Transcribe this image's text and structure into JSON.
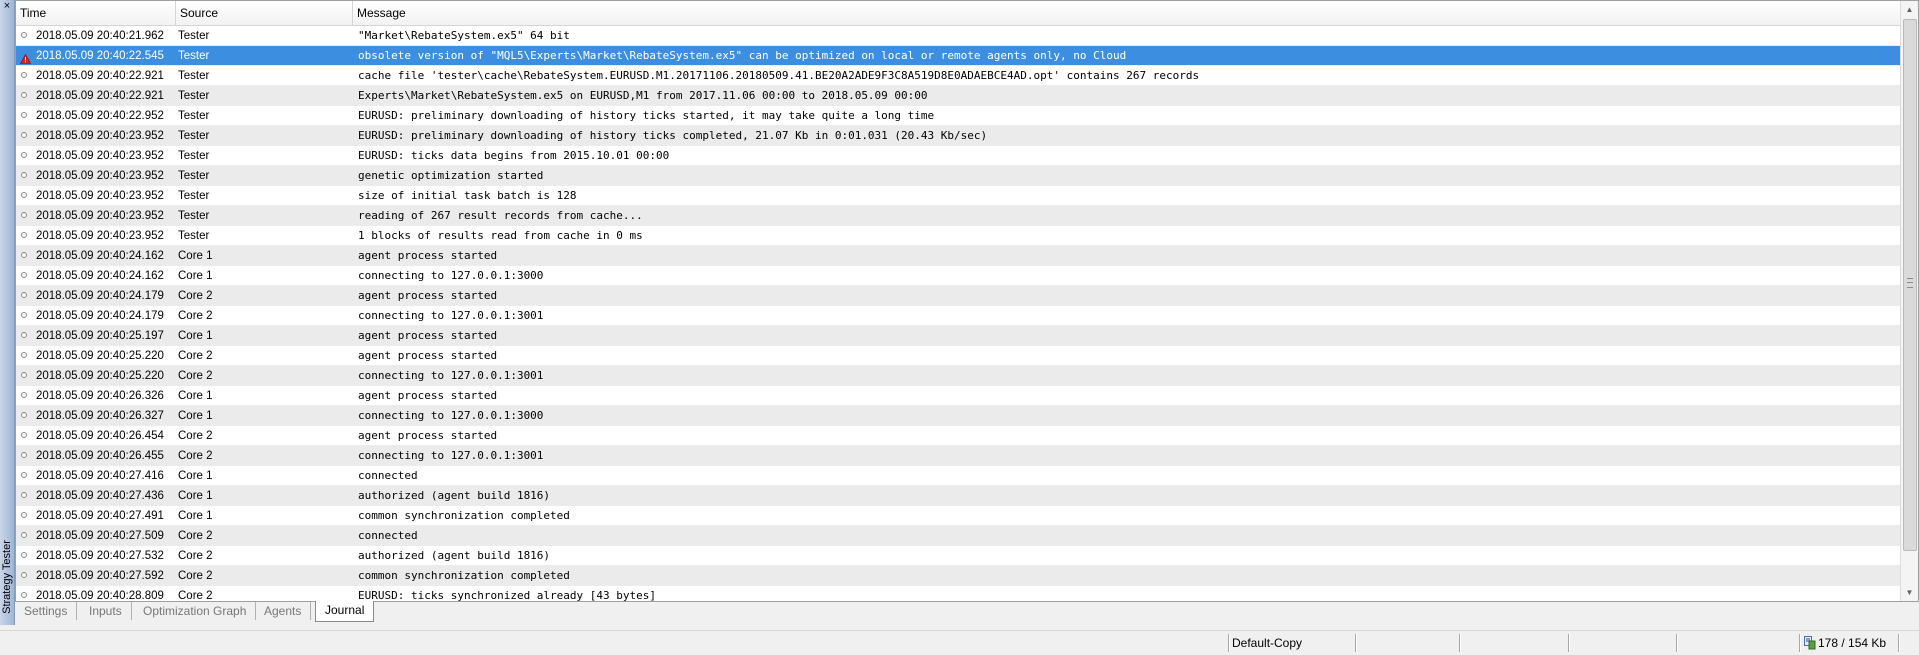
{
  "panel": {
    "vertical_title": "Strategy Tester",
    "close_glyph": "×"
  },
  "columns": {
    "time": "Time",
    "source": "Source",
    "message": "Message"
  },
  "rows": [
    {
      "time": "2018.05.09 20:40:21.962",
      "source": "Tester",
      "message": "\"Market\\RebateSystem.ex5\" 64 bit",
      "icon": "info-icon"
    },
    {
      "time": "2018.05.09 20:40:22.545",
      "source": "Tester",
      "message": "obsolete version of \"MQL5\\Experts\\Market\\RebateSystem.ex5\" can be optimized on local or remote agents only, no Cloud",
      "icon": "warning-icon",
      "selected": true
    },
    {
      "time": "2018.05.09 20:40:22.921",
      "source": "Tester",
      "message": "cache file 'tester\\cache\\RebateSystem.EURUSD.M1.20171106.20180509.41.BE20A2ADE9F3C8A519D8E0ADAEBCE4AD.opt' contains 267 records",
      "icon": "info-icon"
    },
    {
      "time": "2018.05.09 20:40:22.921",
      "source": "Tester",
      "message": "Experts\\Market\\RebateSystem.ex5 on EURUSD,M1 from 2017.11.06 00:00 to 2018.05.09 00:00",
      "icon": "info-icon"
    },
    {
      "time": "2018.05.09 20:40:22.952",
      "source": "Tester",
      "message": "EURUSD: preliminary downloading of history ticks started, it may take quite a long time",
      "icon": "info-icon"
    },
    {
      "time": "2018.05.09 20:40:23.952",
      "source": "Tester",
      "message": "EURUSD: preliminary downloading of history ticks completed, 21.07 Kb in 0:01.031 (20.43 Kb/sec)",
      "icon": "info-icon"
    },
    {
      "time": "2018.05.09 20:40:23.952",
      "source": "Tester",
      "message": "EURUSD: ticks data begins from 2015.10.01 00:00",
      "icon": "info-icon"
    },
    {
      "time": "2018.05.09 20:40:23.952",
      "source": "Tester",
      "message": "genetic optimization started",
      "icon": "info-icon"
    },
    {
      "time": "2018.05.09 20:40:23.952",
      "source": "Tester",
      "message": "size of initial task batch is 128",
      "icon": "info-icon"
    },
    {
      "time": "2018.05.09 20:40:23.952",
      "source": "Tester",
      "message": "reading of 267 result records from cache...",
      "icon": "info-icon"
    },
    {
      "time": "2018.05.09 20:40:23.952",
      "source": "Tester",
      "message": "1 blocks of results read from cache in 0 ms",
      "icon": "info-icon"
    },
    {
      "time": "2018.05.09 20:40:24.162",
      "source": "Core 1",
      "message": "agent process started",
      "icon": "info-icon"
    },
    {
      "time": "2018.05.09 20:40:24.162",
      "source": "Core 1",
      "message": "connecting to 127.0.0.1:3000",
      "icon": "info-icon"
    },
    {
      "time": "2018.05.09 20:40:24.179",
      "source": "Core 2",
      "message": "agent process started",
      "icon": "info-icon"
    },
    {
      "time": "2018.05.09 20:40:24.179",
      "source": "Core 2",
      "message": "connecting to 127.0.0.1:3001",
      "icon": "info-icon"
    },
    {
      "time": "2018.05.09 20:40:25.197",
      "source": "Core 1",
      "message": "agent process started",
      "icon": "info-icon"
    },
    {
      "time": "2018.05.09 20:40:25.220",
      "source": "Core 2",
      "message": "agent process started",
      "icon": "info-icon"
    },
    {
      "time": "2018.05.09 20:40:25.220",
      "source": "Core 2",
      "message": "connecting to 127.0.0.1:3001",
      "icon": "info-icon"
    },
    {
      "time": "2018.05.09 20:40:26.326",
      "source": "Core 1",
      "message": "agent process started",
      "icon": "info-icon"
    },
    {
      "time": "2018.05.09 20:40:26.327",
      "source": "Core 1",
      "message": "connecting to 127.0.0.1:3000",
      "icon": "info-icon"
    },
    {
      "time": "2018.05.09 20:40:26.454",
      "source": "Core 2",
      "message": "agent process started",
      "icon": "info-icon"
    },
    {
      "time": "2018.05.09 20:40:26.455",
      "source": "Core 2",
      "message": "connecting to 127.0.0.1:3001",
      "icon": "info-icon"
    },
    {
      "time": "2018.05.09 20:40:27.416",
      "source": "Core 1",
      "message": "connected",
      "icon": "info-icon"
    },
    {
      "time": "2018.05.09 20:40:27.436",
      "source": "Core 1",
      "message": "authorized (agent build 1816)",
      "icon": "info-icon"
    },
    {
      "time": "2018.05.09 20:40:27.491",
      "source": "Core 1",
      "message": "common synchronization completed",
      "icon": "info-icon"
    },
    {
      "time": "2018.05.09 20:40:27.509",
      "source": "Core 2",
      "message": "connected",
      "icon": "info-icon"
    },
    {
      "time": "2018.05.09 20:40:27.532",
      "source": "Core 2",
      "message": "authorized (agent build 1816)",
      "icon": "info-icon"
    },
    {
      "time": "2018.05.09 20:40:27.592",
      "source": "Core 2",
      "message": "common synchronization completed",
      "icon": "info-icon"
    },
    {
      "time": "2018.05.09 20:40:28.809",
      "source": "Core 2",
      "message": "EURUSD: ticks synchronized already [43 bytes]",
      "icon": "info-icon"
    }
  ],
  "tabs": [
    {
      "label": "Settings",
      "name": "tab-settings"
    },
    {
      "label": "Inputs",
      "name": "tab-inputs"
    },
    {
      "label": "Optimization Graph",
      "name": "tab-optimization-graph"
    },
    {
      "label": "Agents",
      "name": "tab-agents"
    },
    {
      "label": "Journal",
      "name": "tab-journal",
      "active": true
    }
  ],
  "statusbar": {
    "profile": "Default-Copy",
    "traffic": "178 / 154 Kb",
    "traffic_icon": "network-traffic-icon"
  },
  "colors": {
    "selection": "#3c8ee0",
    "alt_row": "#ebebeb",
    "warning": "#d9261c"
  }
}
